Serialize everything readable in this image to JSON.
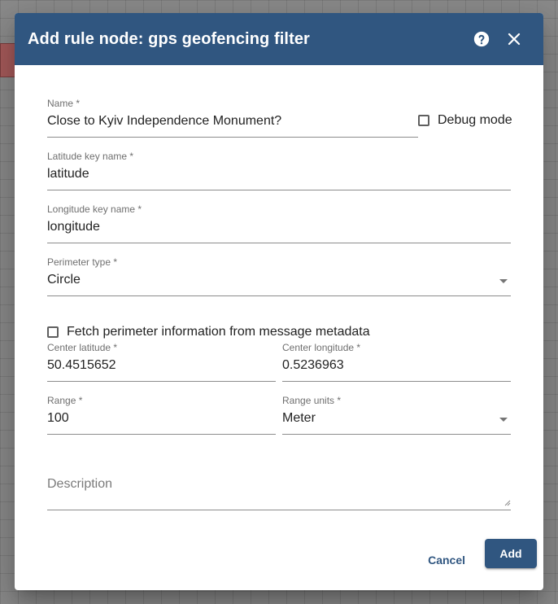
{
  "dialog": {
    "title": "Add rule node: gps geofencing filter",
    "help_icon": "help-circle-icon",
    "close_icon": "close-icon"
  },
  "form": {
    "name": {
      "label": "Name *",
      "value": "Close to Kyiv Independence Monument?"
    },
    "debug_mode": {
      "label": "Debug mode",
      "checked": false
    },
    "latitude_key": {
      "label": "Latitude key name *",
      "value": "latitude"
    },
    "longitude_key": {
      "label": "Longitude key name *",
      "value": "longitude"
    },
    "perimeter_type": {
      "label": "Perimeter type *",
      "value": "Circle"
    },
    "fetch_metadata": {
      "label": "Fetch perimeter information from message metadata",
      "checked": false
    },
    "center_latitude": {
      "label": "Center latitude *",
      "value": "50.4515652"
    },
    "center_longitude": {
      "label": "Center longitude *",
      "value": "0.5236963"
    },
    "range": {
      "label": "Range *",
      "value": "100"
    },
    "range_units": {
      "label": "Range units *",
      "value": "Meter"
    },
    "description": {
      "placeholder": "Description",
      "value": ""
    }
  },
  "actions": {
    "cancel_label": "Cancel",
    "add_label": "Add"
  },
  "colors": {
    "primary": "#305680",
    "background_node": "#a65a5a"
  }
}
